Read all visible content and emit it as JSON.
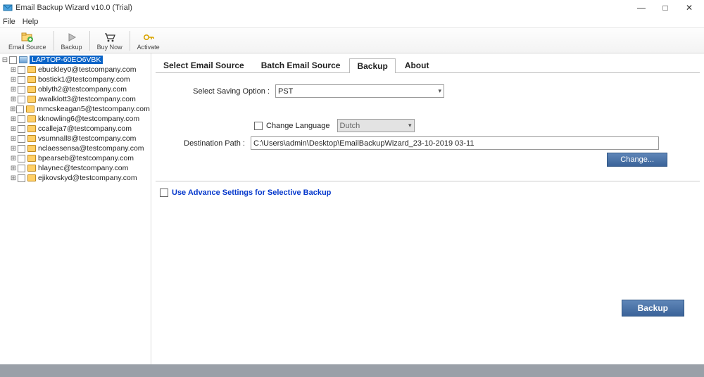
{
  "window": {
    "title": "Email Backup Wizard v10.0 (Trial)",
    "minimize": "—",
    "maximize": "□",
    "close": "✕"
  },
  "menu": {
    "file": "File",
    "help": "Help"
  },
  "toolbar": {
    "email_source": "Email Source",
    "backup": "Backup",
    "buy_now": "Buy Now",
    "activate": "Activate"
  },
  "tree": {
    "root": "LAPTOP-60EO6VBK",
    "items": [
      "ebuckley0@testcompany.com",
      "bostick1@testcompany.com",
      "oblyth2@testcompany.com",
      "awalklott3@testcompany.com",
      "mmcskeagan5@testcompany.com",
      "kknowling6@testcompany.com",
      "ccalleja7@testcompany.com",
      "vsumnall8@testcompany.com",
      "nclaessensa@testcompany.com",
      "bpearseb@testcompany.com",
      "hlaynec@testcompany.com",
      "ejikovskyd@testcompany.com"
    ]
  },
  "tabs": {
    "select_source": "Select Email Source",
    "batch_source": "Batch Email Source",
    "backup": "Backup",
    "about": "About"
  },
  "form": {
    "saving_option_label": "Select Saving Option :",
    "saving_option_value": "PST",
    "change_language_label": "Change Language",
    "language_value": "Dutch",
    "destination_label": "Destination Path :",
    "destination_value": "C:\\Users\\admin\\Desktop\\EmailBackupWizard_23-10-2019 03-11",
    "change_button": "Change...",
    "advance_label": "Use Advance Settings for Selective Backup",
    "backup_button": "Backup"
  }
}
